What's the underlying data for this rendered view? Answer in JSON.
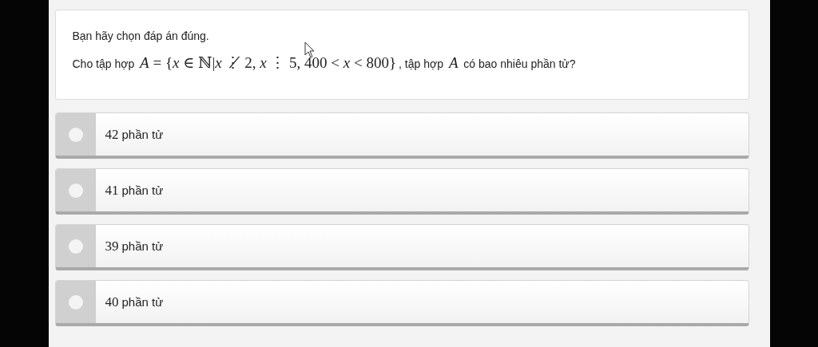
{
  "question": {
    "instruction": "Bạn hãy chọn đáp án đúng.",
    "parts": [
      {
        "kind": "text",
        "value": "Cho tập hợp "
      },
      {
        "kind": "math",
        "value": "*A* = {*x* ∈ ℕ|*x* ⋮̸ 2, *x* ⋮ 5, 400 < *x* < 800}"
      },
      {
        "kind": "text",
        "value": ", tập hợp "
      },
      {
        "kind": "math",
        "value": "*A*"
      },
      {
        "kind": "text",
        "value": " có bao nhiêu phần tử?"
      }
    ]
  },
  "options": [
    {
      "number": "42",
      "text": "phần tử",
      "selected": false
    },
    {
      "number": "41",
      "text": "phần tử",
      "selected": false
    },
    {
      "number": "39",
      "text": "phần tử",
      "selected": false
    },
    {
      "number": "40",
      "text": "phần tử",
      "selected": false
    }
  ]
}
